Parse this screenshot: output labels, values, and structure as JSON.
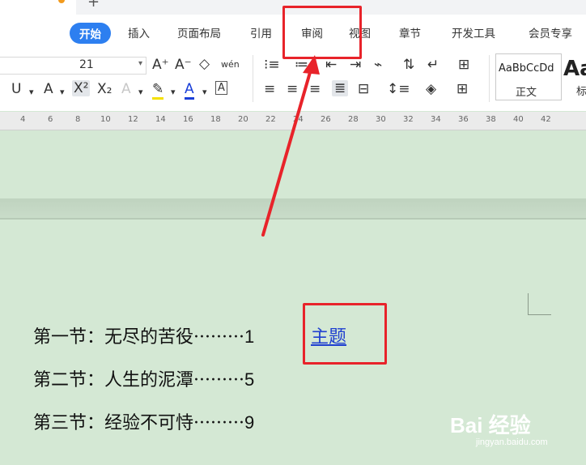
{
  "tabs_bar": {
    "plus": "+"
  },
  "menu": {
    "items": [
      {
        "label": "开始",
        "active": true
      },
      {
        "label": "插入"
      },
      {
        "label": "页面布局"
      },
      {
        "label": "引用"
      },
      {
        "label": "审阅"
      },
      {
        "label": "视图"
      },
      {
        "label": "章节"
      },
      {
        "label": "开发工具"
      },
      {
        "label": "会员专享"
      }
    ]
  },
  "toolbar": {
    "font_size": "21",
    "styles": [
      {
        "sample": "AaBbCcDd",
        "name": "正文"
      },
      {
        "sample": "Aa",
        "name": "标"
      }
    ]
  },
  "ruler": {
    "numbers": [
      "4",
      "6",
      "8",
      "10",
      "12",
      "14",
      "16",
      "18",
      "20",
      "22",
      "24",
      "26",
      "28",
      "30",
      "32",
      "34",
      "36",
      "38",
      "40",
      "42"
    ]
  },
  "document": {
    "toc": [
      {
        "text": "第一节：无尽的苦役·········",
        "page": "1"
      },
      {
        "text": "第二节：人生的泥潭·········",
        "page": "5"
      },
      {
        "text": "第三节：经验不可恃·········",
        "page": "9"
      }
    ],
    "link_text": "主题"
  },
  "annotation": {
    "color": "#e8232a"
  },
  "watermark": {
    "brand": "Bai 经验",
    "url": "jingyan.baidu.com"
  }
}
